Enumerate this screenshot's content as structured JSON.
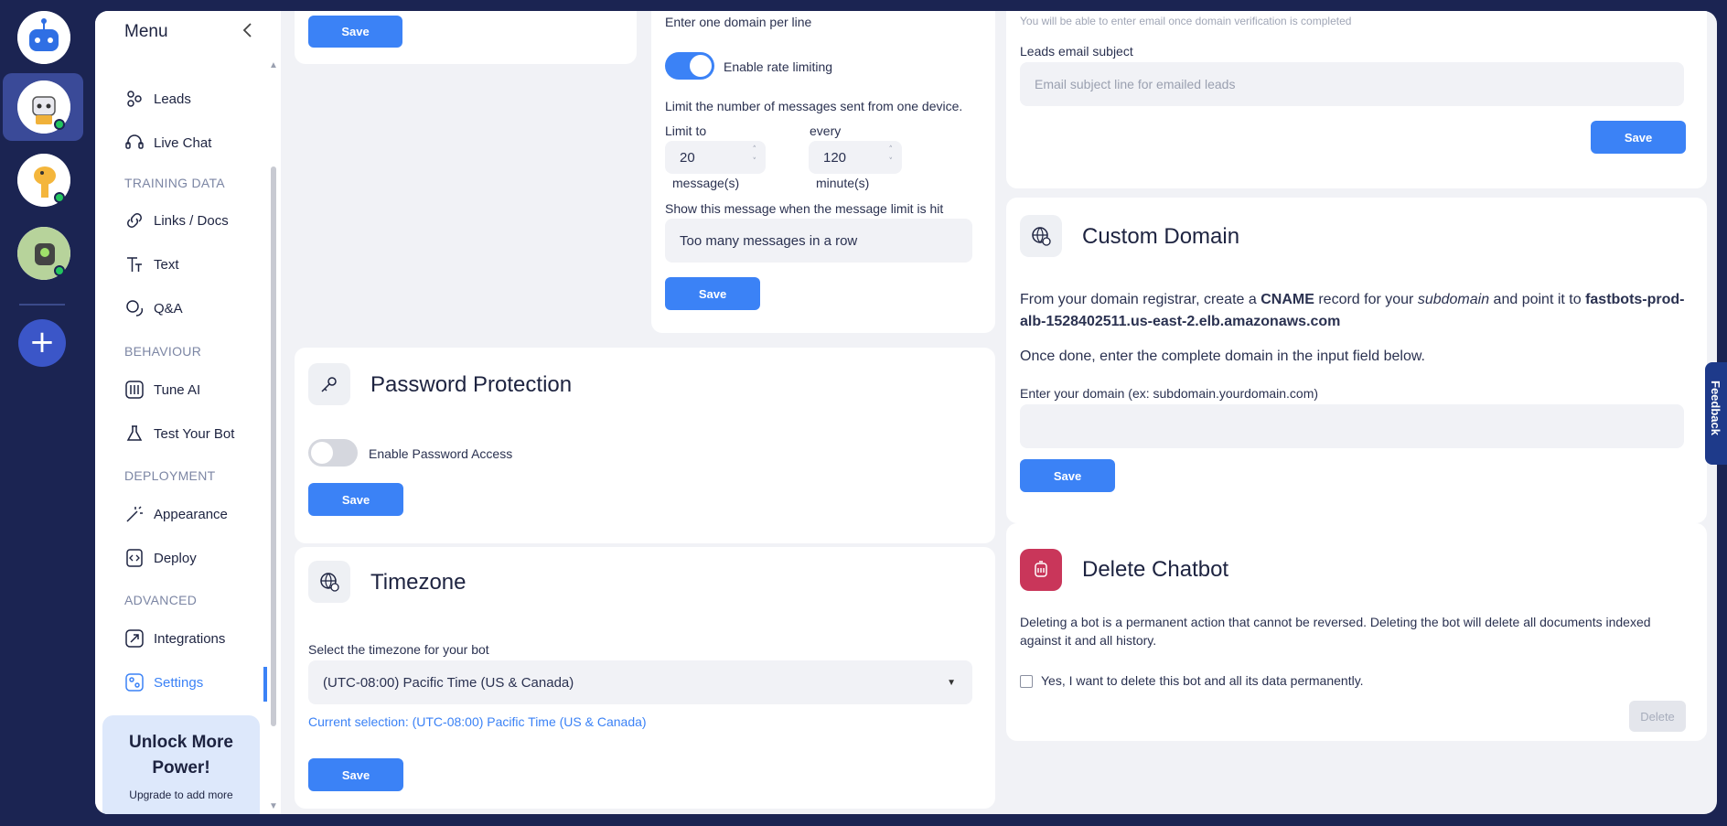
{
  "rail": {
    "add_label": "+"
  },
  "sidebar": {
    "title": "Menu",
    "collapse_icon": "chevron-left-icon",
    "items": {
      "leads": "Leads",
      "live_chat": "Live Chat",
      "links_docs": "Links / Docs",
      "text": "Text",
      "qa": "Q&A",
      "tune_ai": "Tune AI",
      "test_bot": "Test Your Bot",
      "appearance": "Appearance",
      "deploy": "Deploy",
      "integrations": "Integrations",
      "settings": "Settings"
    },
    "sections": {
      "training": "TRAINING DATA",
      "behaviour": "BEHAVIOUR",
      "deployment": "DEPLOYMENT",
      "advanced": "ADVANCED"
    },
    "upgrade": {
      "title": "Unlock More Power!",
      "subtitle": "Upgrade to add more"
    }
  },
  "top_left_card": {
    "save_label": "Save"
  },
  "rate_card": {
    "domain_hint": "Enter one domain per line",
    "toggle_label": "Enable rate limiting",
    "toggle_on": true,
    "limit_desc": "Limit the number of messages sent from one device.",
    "limit_to_label": "Limit to",
    "every_label": "every",
    "limit_value": "20",
    "every_value": "120",
    "messages_unit": "message(s)",
    "minutes_unit": "minute(s)",
    "limit_msg_label": "Show this message when the message limit is hit",
    "limit_msg_value": "Too many messages in a row",
    "save_label": "Save"
  },
  "password_card": {
    "title": "Password Protection",
    "toggle_label": "Enable Password Access",
    "toggle_on": false,
    "save_label": "Save"
  },
  "timezone_card": {
    "title": "Timezone",
    "select_label": "Select the timezone for your bot",
    "selected": "(UTC-08:00) Pacific Time (US & Canada)",
    "current": "Current selection: (UTC-08:00) Pacific Time (US & Canada)",
    "save_label": "Save"
  },
  "email_card": {
    "verify_note": "You will be able to enter email once domain verification is completed",
    "subject_label": "Leads email subject",
    "subject_placeholder": "Email subject line for emailed leads",
    "save_label": "Save"
  },
  "domain_card": {
    "title": "Custom Domain",
    "text_1": "From your domain registrar, create a ",
    "text_cname": "CNAME",
    "text_2": " record for your ",
    "text_subdomain": "subdomain",
    "text_3": " and point it to ",
    "text_target": "fastbots-prod-alb-1528402511.us-east-2.elb.amazonaws.com",
    "text_done": "Once done, enter the complete domain in the input field below.",
    "input_label": "Enter your domain (ex: subdomain.yourdomain.com)",
    "input_value": "",
    "save_label": "Save"
  },
  "delete_card": {
    "title": "Delete Chatbot",
    "warning": "Deleting a bot is a permanent action that cannot be reversed. Deleting the bot will delete all documents indexed against it and all history.",
    "confirm_label": "Yes, I want to delete this bot and all its data permanently.",
    "confirm_checked": false,
    "delete_label": "Delete"
  },
  "feedback_label": "Feedback",
  "colors": {
    "accent": "#3b82f6",
    "danger": "#c9365a",
    "navy": "#1b2452"
  }
}
